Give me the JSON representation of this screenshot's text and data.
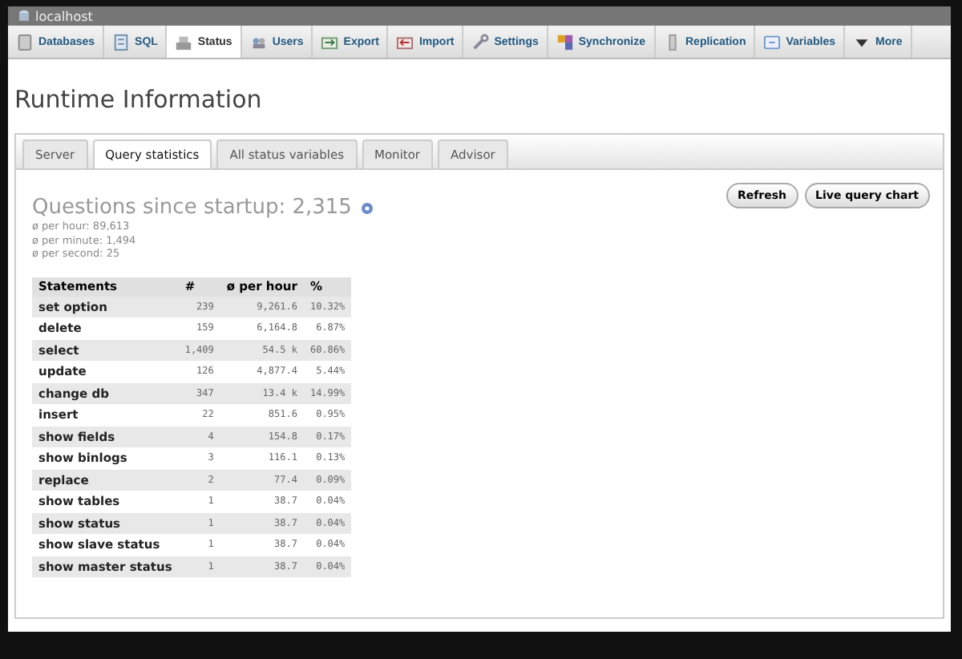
{
  "window": {
    "title": "localhost"
  },
  "nav_tabs": [
    {
      "label": "Databases",
      "selected": false
    },
    {
      "label": "SQL",
      "selected": false
    },
    {
      "label": "Status",
      "selected": true
    },
    {
      "label": "Users",
      "selected": false
    },
    {
      "label": "Export",
      "selected": false
    },
    {
      "label": "Import",
      "selected": false
    },
    {
      "label": "Settings",
      "selected": false
    },
    {
      "label": "Synchronize",
      "selected": false
    },
    {
      "label": "Replication",
      "selected": false
    },
    {
      "label": "Variables",
      "selected": false
    },
    {
      "label": "More",
      "selected": false
    }
  ],
  "page_title": "Runtime Information",
  "sub_tabs": [
    {
      "label": "Server",
      "selected": false
    },
    {
      "label": "Query statistics",
      "selected": true
    },
    {
      "label": "All status variables",
      "selected": false
    },
    {
      "label": "Monitor",
      "selected": false
    },
    {
      "label": "Advisor",
      "selected": false
    }
  ],
  "heading": "Questions since startup: 2,315",
  "stats": [
    "ø per hour: 89,613",
    "ø per minute: 1,494",
    "ø per second: 25"
  ],
  "buttons": [
    "Refresh",
    "Live query chart"
  ],
  "table": {
    "columns": [
      "Statements",
      "#",
      "ø per hour",
      "%"
    ],
    "rows": [
      [
        "set option",
        "239",
        "9,261.6",
        "10.32%"
      ],
      [
        "delete",
        "159",
        "6,164.8",
        "6.87%"
      ],
      [
        "select",
        "1,409",
        "54.5 k",
        "60.86%"
      ],
      [
        "update",
        "126",
        "4,877.4",
        "5.44%"
      ],
      [
        "change db",
        "347",
        "13.4 k",
        "14.99%"
      ],
      [
        "insert",
        "22",
        "851.6",
        "0.95%"
      ],
      [
        "show fields",
        "4",
        "154.8",
        "0.17%"
      ],
      [
        "show binlogs",
        "3",
        "116.1",
        "0.13%"
      ],
      [
        "replace",
        "2",
        "77.4",
        "0.09%"
      ],
      [
        "show tables",
        "1",
        "38.7",
        "0.04%"
      ],
      [
        "show status",
        "1",
        "38.7",
        "0.04%"
      ],
      [
        "show slave status",
        "1",
        "38.7",
        "0.04%"
      ],
      [
        "show master status",
        "1",
        "38.7",
        "0.04%"
      ]
    ]
  }
}
